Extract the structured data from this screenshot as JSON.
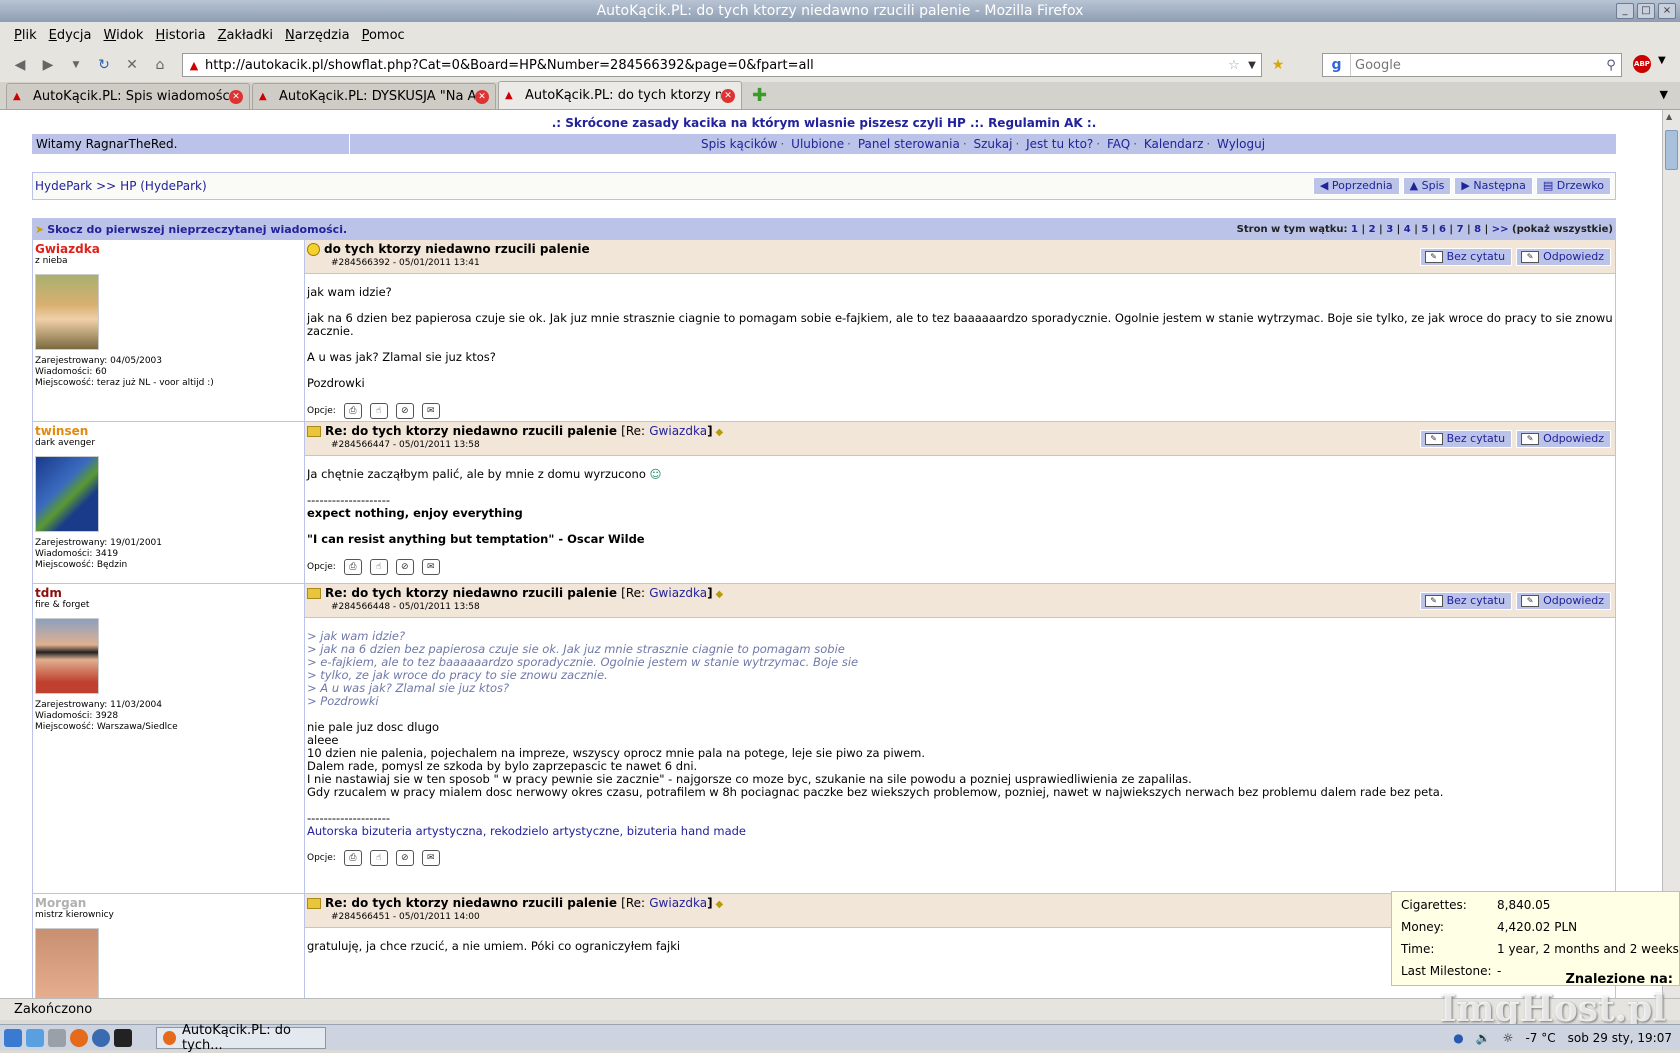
{
  "window": {
    "title": "AutoKącik.PL: do tych ktorzy niedawno rzucili palenie - Mozilla Firefox"
  },
  "menu": [
    "Plik",
    "Edycja",
    "Widok",
    "Historia",
    "Zakładki",
    "Narzędzia",
    "Pomoc"
  ],
  "nav": {
    "url": "http://autokacik.pl/showflat.php?Cat=0&Board=HP&Number=284566392&page=0&fpart=all",
    "search_placeholder": "Google"
  },
  "tabs": [
    {
      "label": "AutoKącik.PL: Spis wiadomości ..."
    },
    {
      "label": "AutoKącik.PL: DYSKUSJA \"Na A..."
    },
    {
      "label": "AutoKącik.PL: do tych ktorzy ni..."
    }
  ],
  "page": {
    "rules_link": ".: Skrócone zasady kacika na którym wlasnie piszesz czyli HP .:. Regulamin AK :.",
    "welcome": "Witamy RagnarTheRed.",
    "toplinks": [
      "Spis kącików",
      "Ulubione",
      "Panel sterowania",
      "Szukaj",
      "Jest tu kto?",
      "FAQ",
      "Kalendarz",
      "Wyloguj"
    ],
    "breadcrumb": [
      "HydePark",
      ">>",
      "HP (HydePark)"
    ],
    "pagenav": [
      "Poprzednia",
      "Spis",
      "Następna",
      "Drzewko"
    ],
    "jump": "Skocz do pierwszej nieprzeczytanej wiadomości.",
    "pages_label": "Stron w tym wątku:",
    "pages": [
      "1",
      "2",
      "3",
      "4",
      "5",
      "6",
      "7",
      "8",
      ">>"
    ],
    "pages_all": "(pokaż wszystkie)",
    "options_label": "Opcje:",
    "btn_noquote": "Bez cytatu",
    "btn_reply": "Odpowiedz"
  },
  "posts": [
    {
      "nick": "Gwiazdka",
      "nick_color": "#e0201a",
      "user_title": "z nieba",
      "registered": "Zarejestrowany: 04/05/2003",
      "messages": "Wiadomości: 60",
      "location": "Miejscowość: teraz już NL - voor altijd :)",
      "subject": "do tych ktorzy niedawno rzucili palenie",
      "re_prefix": "",
      "re_user": "",
      "pid": "#284566392 - 05/01/2011 13:41",
      "body": [
        "jak wam idzie?",
        "jak na 6 dzien bez papierosa czuje sie ok. Jak juz mnie strasznie ciagnie to pomagam sobie e-fajkiem, ale to tez baaaaaardzo sporadycznie. Ogolnie jestem w stanie wytrzymac. Boje sie tylko, ze jak wroce do pracy to sie znowu zacznie.",
        "A u was jak? Zlamal sie juz ktos?",
        "Pozdrowki"
      ]
    },
    {
      "nick": "twinsen",
      "nick_color": "#e08a10",
      "user_title": "dark avenger",
      "registered": "Zarejestrowany: 19/01/2001",
      "messages": "Wiadomości: 3419",
      "location": "Miejscowość: Będzin",
      "subject": "Re: do tych ktorzy niedawno rzucili palenie",
      "re_prefix": "[Re:",
      "re_user": "Gwiazdka",
      "pid": "#284566447 - 05/01/2011 13:58",
      "body": [
        "Ja chętnie zacząłbym palić, ale by mnie z domu wyrzucono"
      ],
      "sig": [
        "--------------------",
        "expect nothing, enjoy everything",
        "\"I can resist anything but temptation\" - Oscar Wilde"
      ]
    },
    {
      "nick": "tdm",
      "nick_color": "#8a1010",
      "user_title": "fire & forget",
      "registered": "Zarejestrowany: 11/03/2004",
      "messages": "Wiadomości: 3928",
      "location": "Miejscowość: Warszawa/Siedlce",
      "subject": "Re: do tych ktorzy niedawno rzucili palenie",
      "re_prefix": "[Re:",
      "re_user": "Gwiazdka",
      "pid": "#284566448 - 05/01/2011 13:58",
      "quote": [
        "> jak wam idzie?",
        "> jak na 6 dzien bez papierosa czuje sie ok. Jak juz mnie strasznie ciagnie to pomagam sobie",
        "> e-fajkiem, ale to tez baaaaaardzo sporadycznie. Ogolnie jestem w stanie wytrzymac. Boje sie",
        "> tylko, ze jak wroce do pracy to sie znowu zacznie.",
        "> A u was jak? Zlamal sie juz ktos?",
        "> Pozdrowki"
      ],
      "body": [
        "nie pale juz dosc dlugo",
        "aleee",
        "10 dzien nie palenia, pojechalem na impreze, wszyscy oprocz mnie pala na potege, leje sie piwo za piwem.",
        "Dalem rade, pomysl ze szkoda by bylo zaprzepascic te nawet 6 dni.",
        "I nie nastawiaj sie w ten sposob \" w pracy pewnie sie zacznie\" - najgorsze co moze byc, szukanie na sile powodu a pozniej usprawiedliwienia ze zapalilas.",
        "Gdy rzucalem w pracy mialem dosc nerwowy okres czasu, potrafilem w 8h pociagnac paczke bez wiekszych problemow, pozniej, nawet w najwiekszych nerwach bez problemu dalem rade bez peta."
      ],
      "sig_sep": "--------------------",
      "sig_link": "Autorska bizuteria artystyczna, rekodzielo artystyczne, bizuteria hand made"
    },
    {
      "nick": "Morgan",
      "nick_color": "#b0b0b0",
      "user_title": "mistrz kierownicy",
      "subject": "Re: do tych ktorzy niedawno rzucili palenie",
      "re_prefix": "[Re:",
      "re_user": "Gwiazdka",
      "pid": "#284566451 - 05/01/2011 14:00",
      "body": [
        "gratuluję, ja chce rzucić, a nie umiem. Póki co ograniczyłem fajki"
      ]
    }
  ],
  "quit_tooltip": {
    "cig_label": "Cigarettes:",
    "cig_value": "8,840.05",
    "money_label": "Money:",
    "money_value": "4,420.02 PLN",
    "time_label": "Time:",
    "time_value": "1 year, 2 months and 2 weeks",
    "milestone_label": "Last Milestone:",
    "milestone_value": "-",
    "found": "Znalezione na:"
  },
  "status": "Zakończono",
  "taskbar": {
    "task_label": "AutoKącik.PL: do tych...",
    "temp": "-7 °C",
    "clock": "sob 29 sty, 19:07"
  },
  "watermark": "ImgHost.pl"
}
